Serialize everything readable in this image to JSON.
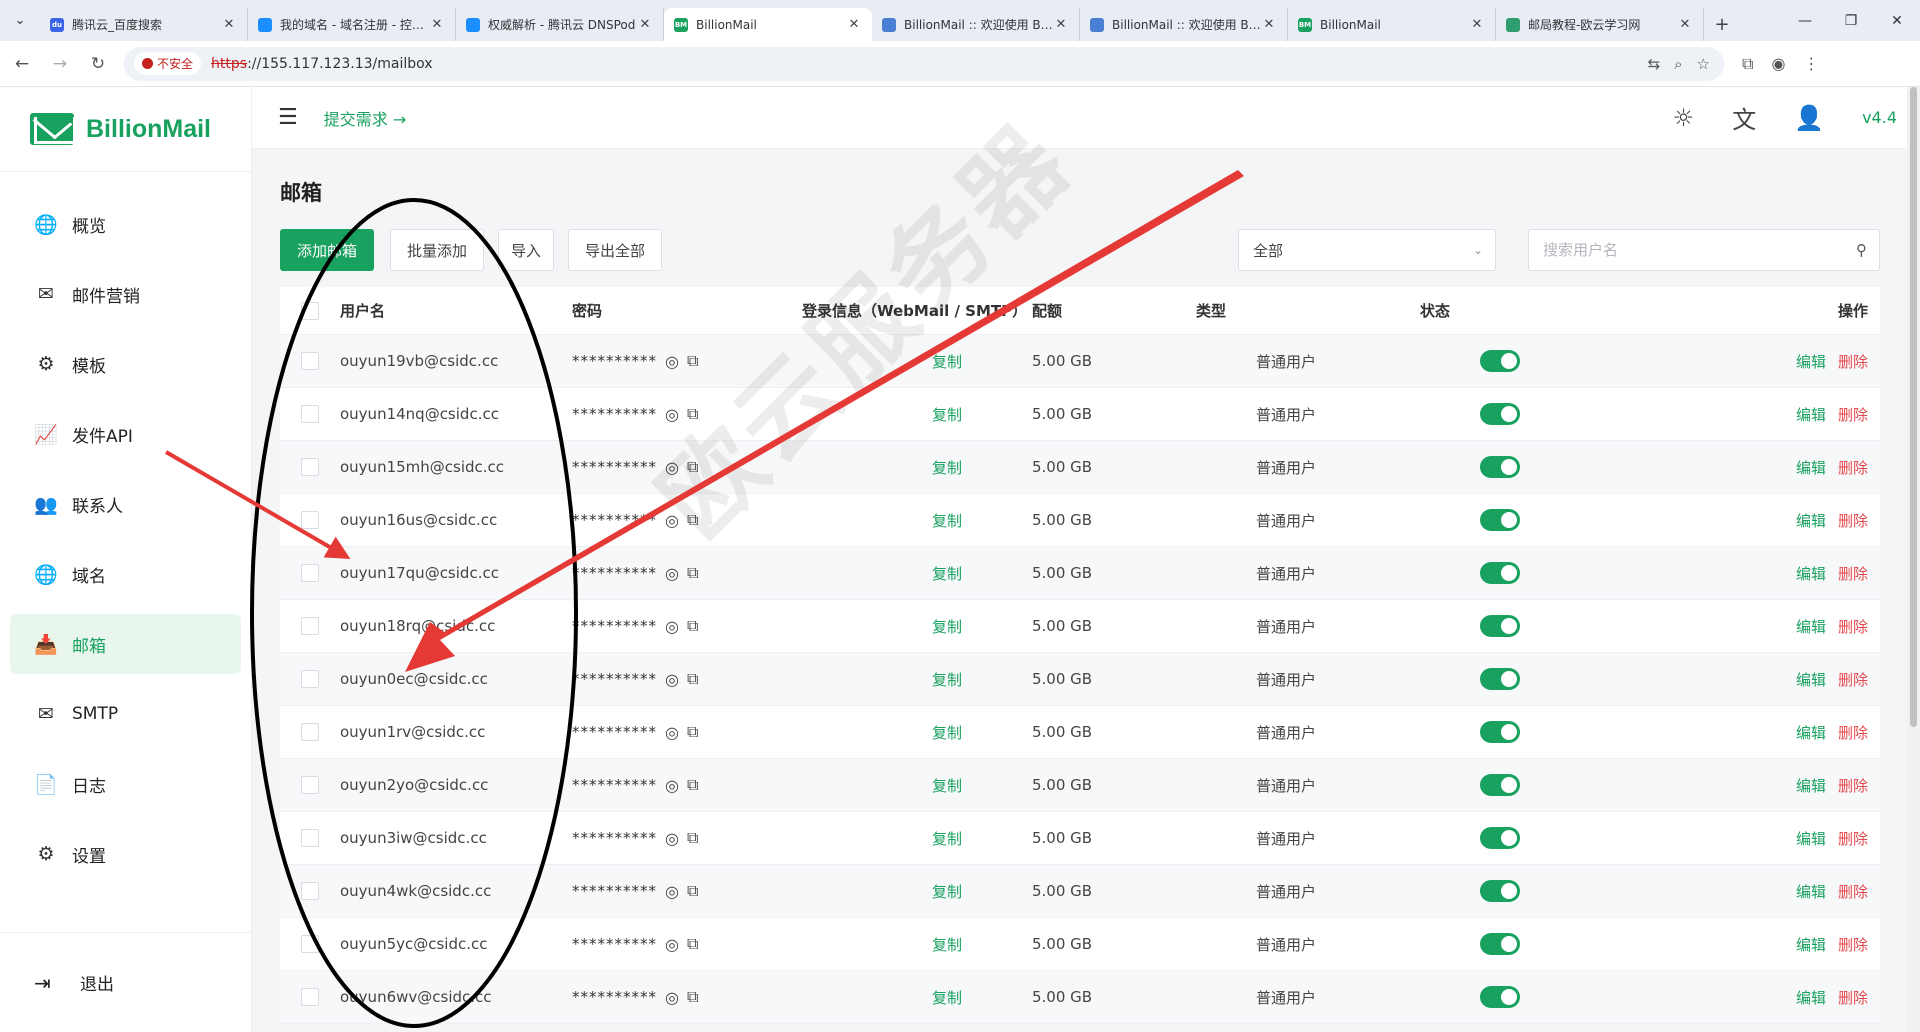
{
  "browser": {
    "tabs": [
      {
        "title": "腾讯云_百度搜索",
        "fav_color": "#3b64e8",
        "fav_text": "du"
      },
      {
        "title": "我的域名 - 域名注册 - 控制台",
        "fav_color": "#1a8dff",
        "fav_text": ""
      },
      {
        "title": "权威解析 - 腾讯云 DNSPod",
        "fav_color": "#1a8dff",
        "fav_text": ""
      },
      {
        "title": "BillionMail",
        "fav_color": "#19a15f",
        "fav_text": "BM",
        "active": true
      },
      {
        "title": "BillionMail :: 欢迎使用 BillionMail",
        "fav_color": "#4a7fd6",
        "fav_text": ""
      },
      {
        "title": "BillionMail :: 欢迎使用 BillionMail",
        "fav_color": "#4a7fd6",
        "fav_text": ""
      },
      {
        "title": "BillionMail",
        "fav_color": "#19a15f",
        "fav_text": "BM"
      },
      {
        "title": "邮局教程-欧云学习网",
        "fav_color": "#2f9e6e",
        "fav_text": ""
      }
    ],
    "insecure_label": "不安全",
    "url_proto": "https",
    "url_rest": "://155.117.123.13/mailbox"
  },
  "app": {
    "logo_text": "BillionMail",
    "submit_link": "提交需求 →",
    "version": "v4.4"
  },
  "sidebar": {
    "items": [
      {
        "label": "概览",
        "icon": "globe-icon",
        "glyph": "🌐"
      },
      {
        "label": "邮件营销",
        "icon": "mail-list-icon",
        "glyph": "✉"
      },
      {
        "label": "模板",
        "icon": "gear-icon",
        "glyph": "⚙"
      },
      {
        "label": "发件API",
        "icon": "chart-icon",
        "glyph": "📈"
      },
      {
        "label": "联系人",
        "icon": "contacts-icon",
        "glyph": "👥"
      },
      {
        "label": "域名",
        "icon": "globe-icon",
        "glyph": "🌐"
      },
      {
        "label": "邮箱",
        "icon": "inbox-icon",
        "glyph": "📥",
        "active": true
      },
      {
        "label": "SMTP",
        "icon": "smtp-icon",
        "glyph": "✉"
      },
      {
        "label": "日志",
        "icon": "log-icon",
        "glyph": "📄"
      },
      {
        "label": "设置",
        "icon": "settings-icon",
        "glyph": "⚙"
      }
    ],
    "logout": "退出"
  },
  "main": {
    "title": "邮箱",
    "buttons": {
      "add": "添加邮箱",
      "batch_add": "批量添加",
      "import": "导入",
      "export_all": "导出全部"
    },
    "filter_value": "全部",
    "search_placeholder": "搜索用户名",
    "columns": {
      "username": "用户名",
      "password": "密码",
      "login_info": "登录信息（WebMail / SMTP）",
      "quota": "配额",
      "type": "类型",
      "status": "状态",
      "actions": "操作"
    },
    "rows": [
      {
        "user": "ouyun19vb@csidc.cc",
        "password": "**********",
        "login": "复制",
        "quota": "5.00 GB",
        "type": "普通用户",
        "enabled": true,
        "edit": "编辑",
        "delete": "删除"
      },
      {
        "user": "ouyun14nq@csidc.cc",
        "password": "**********",
        "login": "复制",
        "quota": "5.00 GB",
        "type": "普通用户",
        "enabled": true,
        "edit": "编辑",
        "delete": "删除"
      },
      {
        "user": "ouyun15mh@csidc.cc",
        "password": "**********",
        "login": "复制",
        "quota": "5.00 GB",
        "type": "普通用户",
        "enabled": true,
        "edit": "编辑",
        "delete": "删除"
      },
      {
        "user": "ouyun16us@csidc.cc",
        "password": "**********",
        "login": "复制",
        "quota": "5.00 GB",
        "type": "普通用户",
        "enabled": true,
        "edit": "编辑",
        "delete": "删除"
      },
      {
        "user": "ouyun17qu@csidc.cc",
        "password": "**********",
        "login": "复制",
        "quota": "5.00 GB",
        "type": "普通用户",
        "enabled": true,
        "edit": "编辑",
        "delete": "删除"
      },
      {
        "user": "ouyun18rq@csidc.cc",
        "password": "**********",
        "login": "复制",
        "quota": "5.00 GB",
        "type": "普通用户",
        "enabled": true,
        "edit": "编辑",
        "delete": "删除"
      },
      {
        "user": "ouyun0ec@csidc.cc",
        "password": "**********",
        "login": "复制",
        "quota": "5.00 GB",
        "type": "普通用户",
        "enabled": true,
        "edit": "编辑",
        "delete": "删除"
      },
      {
        "user": "ouyun1rv@csidc.cc",
        "password": "**********",
        "login": "复制",
        "quota": "5.00 GB",
        "type": "普通用户",
        "enabled": true,
        "edit": "编辑",
        "delete": "删除"
      },
      {
        "user": "ouyun2yo@csidc.cc",
        "password": "**********",
        "login": "复制",
        "quota": "5.00 GB",
        "type": "普通用户",
        "enabled": true,
        "edit": "编辑",
        "delete": "删除"
      },
      {
        "user": "ouyun3iw@csidc.cc",
        "password": "**********",
        "login": "复制",
        "quota": "5.00 GB",
        "type": "普通用户",
        "enabled": true,
        "edit": "编辑",
        "delete": "删除"
      },
      {
        "user": "ouyun4wk@csidc.cc",
        "password": "**********",
        "login": "复制",
        "quota": "5.00 GB",
        "type": "普通用户",
        "enabled": true,
        "edit": "编辑",
        "delete": "删除"
      },
      {
        "user": "ouyun5yc@csidc.cc",
        "password": "**********",
        "login": "复制",
        "quota": "5.00 GB",
        "type": "普通用户",
        "enabled": true,
        "edit": "编辑",
        "delete": "删除"
      },
      {
        "user": "ouyun6wv@csidc.cc",
        "password": "**********",
        "login": "复制",
        "quota": "5.00 GB",
        "type": "普通用户",
        "enabled": true,
        "edit": "编辑",
        "delete": "删除"
      }
    ]
  },
  "overlay": {
    "watermark": "欧云服务器",
    "annotation_color": "#e53935"
  }
}
